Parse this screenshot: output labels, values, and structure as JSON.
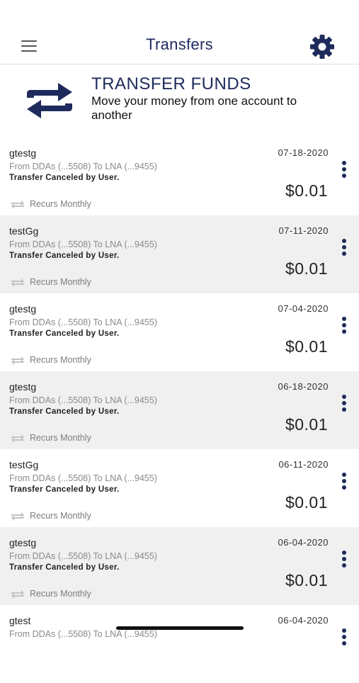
{
  "header": {
    "title": "Transfers",
    "menu_icon": "hamburger-menu-icon",
    "settings_icon": "gear-icon"
  },
  "banner": {
    "title": "TRANSFER FUNDS",
    "subtitle": "Move your money from one account to another",
    "icon": "transfer-arrows-icon",
    "accent_color": "#1f2a5c"
  },
  "transfers": [
    {
      "name": "gtestg",
      "date": "07-18-2020",
      "from": "From DDAs (...5508) To LNA (...9455)",
      "status": "Transfer Canceled by User.",
      "amount": "$0.01",
      "recurrence": "Recurs Monthly"
    },
    {
      "name": "testGg",
      "date": "07-11-2020",
      "from": "From DDAs (...5508) To LNA (...9455)",
      "status": "Transfer Canceled by User.",
      "amount": "$0.01",
      "recurrence": "Recurs Monthly"
    },
    {
      "name": "gtestg",
      "date": "07-04-2020",
      "from": "From DDAs (...5508) To LNA (...9455)",
      "status": "Transfer Canceled by User.",
      "amount": "$0.01",
      "recurrence": "Recurs Monthly"
    },
    {
      "name": "gtestg",
      "date": "06-18-2020",
      "from": "From DDAs (...5508) To LNA (...9455)",
      "status": "Transfer Canceled by User.",
      "amount": "$0.01",
      "recurrence": "Recurs Monthly"
    },
    {
      "name": "testGg",
      "date": "06-11-2020",
      "from": "From DDAs (...5508) To LNA (...9455)",
      "status": "Transfer Canceled by User.",
      "amount": "$0.01",
      "recurrence": "Recurs Monthly"
    },
    {
      "name": "gtestg",
      "date": "06-04-2020",
      "from": "From DDAs (...5508) To LNA (...9455)",
      "status": "Transfer Canceled by User.",
      "amount": "$0.01",
      "recurrence": "Recurs Monthly"
    },
    {
      "name": "gtest",
      "date": "06-04-2020",
      "from": "From DDAs (...5508) To LNA (...9455)",
      "status": "",
      "amount": "",
      "recurrence": ""
    }
  ]
}
